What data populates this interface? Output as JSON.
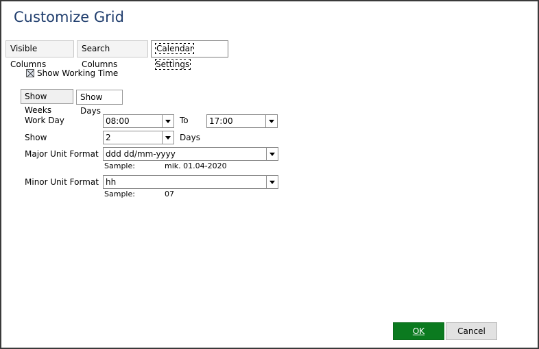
{
  "dialog": {
    "title": "Customize Grid"
  },
  "tabs": [
    {
      "label": "Visible Columns",
      "active": false
    },
    {
      "label": "Search Columns",
      "active": false
    },
    {
      "label": "Calendar Settings",
      "active": true
    }
  ],
  "working_time": {
    "label": "Show Working Time",
    "checked": true
  },
  "view_buttons": {
    "weeks": "Show Weeks",
    "days": "Show Days"
  },
  "work_day": {
    "label": "Work Day",
    "from": "08:00",
    "to_label": "To",
    "to": "17:00"
  },
  "show": {
    "label": "Show",
    "value": "2",
    "unit": "Days"
  },
  "major_unit": {
    "label": "Major Unit Format",
    "value": "ddd dd/mm-yyyy",
    "sample_label": "Sample:",
    "sample_value": "mik. 01.04-2020"
  },
  "minor_unit": {
    "label": "Minor Unit Format",
    "value": "hh",
    "sample_label": "Sample:",
    "sample_value": "07"
  },
  "footer": {
    "ok": "OK",
    "cancel": "Cancel"
  },
  "colors": {
    "title": "#1f3d6d",
    "ok_bg": "#0b7a1f"
  }
}
